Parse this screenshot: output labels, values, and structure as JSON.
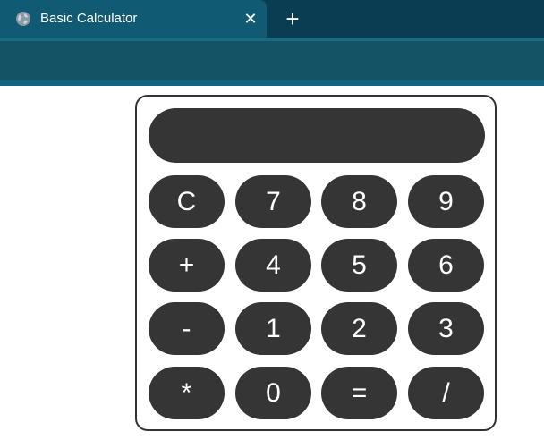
{
  "browser": {
    "tab": {
      "title": "Basic Calculator",
      "favicon": "globe-icon",
      "close_glyph": "✕",
      "active": true
    },
    "new_tab_glyph": "+"
  },
  "calculator": {
    "display_value": "",
    "keys": [
      {
        "label": "C",
        "name": "clear-button"
      },
      {
        "label": "7",
        "name": "digit-7-button"
      },
      {
        "label": "8",
        "name": "digit-8-button"
      },
      {
        "label": "9",
        "name": "digit-9-button"
      },
      {
        "label": "+",
        "name": "add-button"
      },
      {
        "label": "4",
        "name": "digit-4-button"
      },
      {
        "label": "5",
        "name": "digit-5-button"
      },
      {
        "label": "6",
        "name": "digit-6-button"
      },
      {
        "label": "-",
        "name": "subtract-button"
      },
      {
        "label": "1",
        "name": "digit-1-button"
      },
      {
        "label": "2",
        "name": "digit-2-button"
      },
      {
        "label": "3",
        "name": "digit-3-button"
      },
      {
        "label": "*",
        "name": "multiply-button"
      },
      {
        "label": "0",
        "name": "digit-0-button"
      },
      {
        "label": "=",
        "name": "equals-button"
      },
      {
        "label": "/",
        "name": "divide-button"
      }
    ]
  },
  "colors": {
    "tabbar_bg": "#0a3d52",
    "active_tab_bg": "#105a74",
    "toolbar_bg": "#145265",
    "button_bg": "#353535",
    "calculator_border": "#333333",
    "text_light": "#ffffff"
  }
}
